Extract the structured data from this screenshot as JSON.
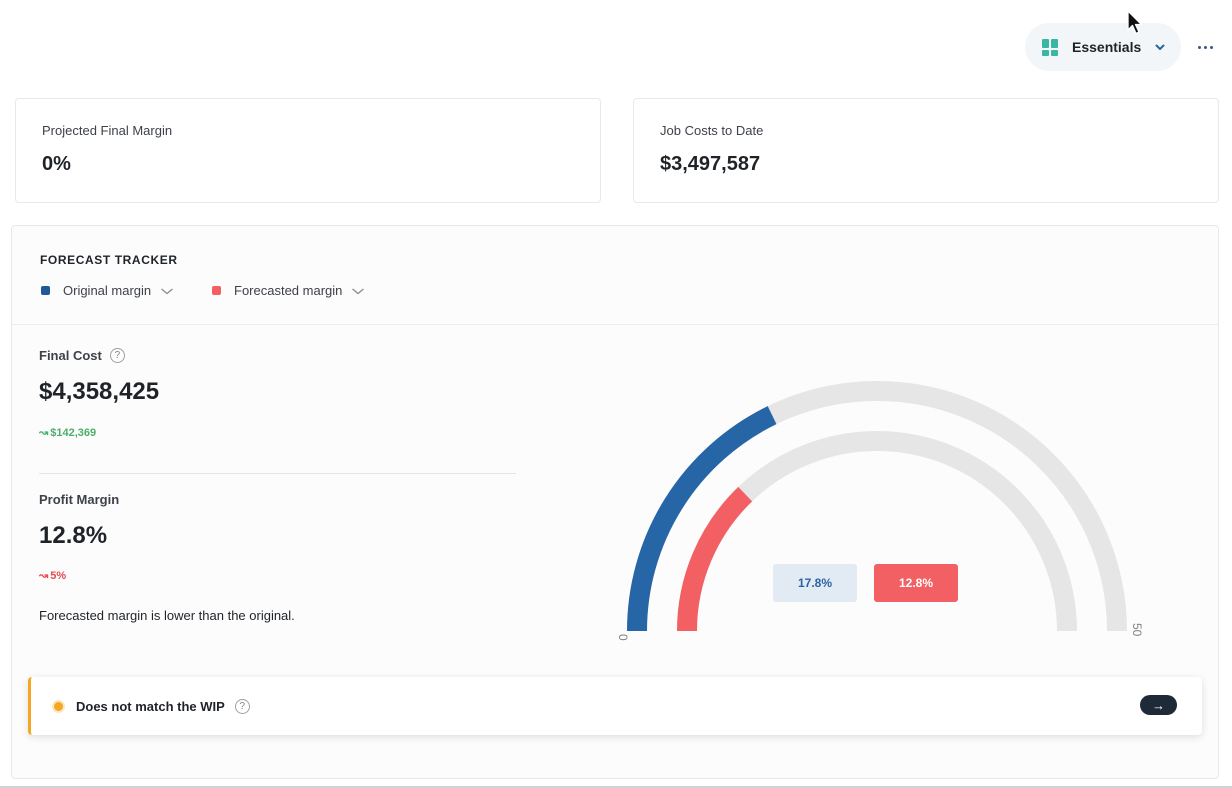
{
  "header": {
    "view_label": "Essentials",
    "more_glyph": "⋯"
  },
  "kpis": [
    {
      "label": "Projected Final Margin",
      "value": "0%"
    },
    {
      "label": "Job Costs to Date",
      "value": "$3,497,587"
    }
  ],
  "forecast": {
    "title": "FORECAST TRACKER",
    "legend": [
      {
        "label": "Original margin",
        "color": "#2766a6"
      },
      {
        "label": "Forecasted margin",
        "color": "#f26063"
      }
    ],
    "final_cost": {
      "label": "Final Cost",
      "value": "$4,358,425",
      "delta": "$142,369",
      "delta_arrow": "↝"
    },
    "profit_margin": {
      "label": "Profit Margin",
      "value": "12.8%",
      "delta": "5%",
      "delta_arrow": "↝"
    },
    "note": "Forecasted margin is lower than the original.",
    "gauge": {
      "min_label": "0",
      "max_label": "50",
      "min": 0,
      "max": 50,
      "original_value": 17.8,
      "forecasted_value": 12.8,
      "original_pill": "17.8%",
      "forecasted_pill": "12.8%",
      "track_color": "#e6e6e6"
    }
  },
  "alert": {
    "text": "Does not match the WIP",
    "action_glyph": "→",
    "accent_color": "#f5a623"
  },
  "help_glyph": "?"
}
